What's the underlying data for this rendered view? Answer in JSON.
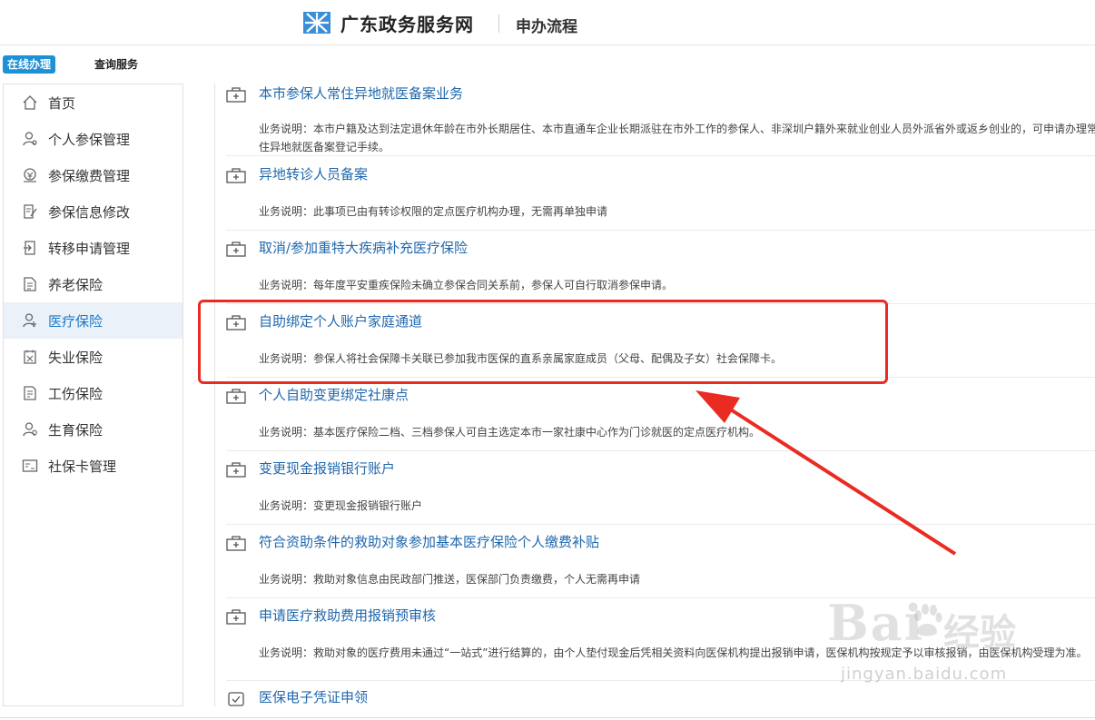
{
  "header": {
    "site_name": "广东政务服务网",
    "subtitle": "申办流程"
  },
  "tabs": [
    {
      "label": "在线办理",
      "active": true
    },
    {
      "label": "查询服务",
      "active": false
    }
  ],
  "sidebar": {
    "items": [
      {
        "label": "首页",
        "icon": "home-icon"
      },
      {
        "label": "个人参保管理",
        "icon": "user-manage-icon"
      },
      {
        "label": "参保缴费管理",
        "icon": "payment-icon"
      },
      {
        "label": "参保信息修改",
        "icon": "edit-doc-icon"
      },
      {
        "label": "转移申请管理",
        "icon": "transfer-icon"
      },
      {
        "label": "养老保险",
        "icon": "document-icon"
      },
      {
        "label": "医疗保险",
        "icon": "medical-user-icon",
        "active": true
      },
      {
        "label": "失业保险",
        "icon": "unemployment-icon"
      },
      {
        "label": "工伤保险",
        "icon": "injury-doc-icon"
      },
      {
        "label": "生育保险",
        "icon": "maternity-icon"
      },
      {
        "label": "社保卡管理",
        "icon": "card-icon"
      }
    ]
  },
  "services": [
    {
      "title": "本市参保人常住异地就医备案业务",
      "desc": "业务说明：本市户籍及达到法定退休年龄在市外长期居住、本市直通车企业长期派驻在市外工作的参保人、非深圳户籍外来就业创业人员外派省外或返乡创业的，可申请办理常住异地就医备案登记手续。"
    },
    {
      "title": "异地转诊人员备案",
      "desc": "业务说明：此事项已由有转诊权限的定点医疗机构办理，无需再单独申请"
    },
    {
      "title": "取消/参加重特大疾病补充医疗保险",
      "desc": "业务说明：每年度平安重疾保险未确立参保合同关系前，参保人可自行取消参保申请。"
    },
    {
      "title": "自助绑定个人账户家庭通道",
      "desc": "业务说明：参保人将社会保障卡关联已参加我市医保的直系亲属家庭成员（父母、配偶及子女）社会保障卡。"
    },
    {
      "title": "个人自助变更绑定社康点",
      "desc": "业务说明：基本医疗保险二档、三档参保人可自主选定本市一家社康中心作为门诊就医的定点医疗机构。"
    },
    {
      "title": "变更现金报销银行账户",
      "desc": "业务说明：变更现金报销银行账户"
    },
    {
      "title": "符合资助条件的救助对象参加基本医疗保险个人缴费补贴",
      "desc": "业务说明：救助对象信息由民政部门推送，医保部门负责缴费，个人无需再申请"
    },
    {
      "title": "申请医疗救助费用报销预审核",
      "desc": "业务说明：救助对象的医疗费用未通过“一站式”进行结算的，由个人垫付现金后凭相关资料向医保机构提出报销申请，医保机构按规定予以审核报销，由医保机构受理为准。"
    },
    {
      "title": "医保电子凭证申领",
      "desc": ""
    }
  ],
  "watermark": {
    "brand": "Bai",
    "cn": "经验",
    "url": "jingyan.baidu.com"
  },
  "colors": {
    "accent": "#1e90d6",
    "link": "#2168ad",
    "highlight": "#ea2b22"
  }
}
